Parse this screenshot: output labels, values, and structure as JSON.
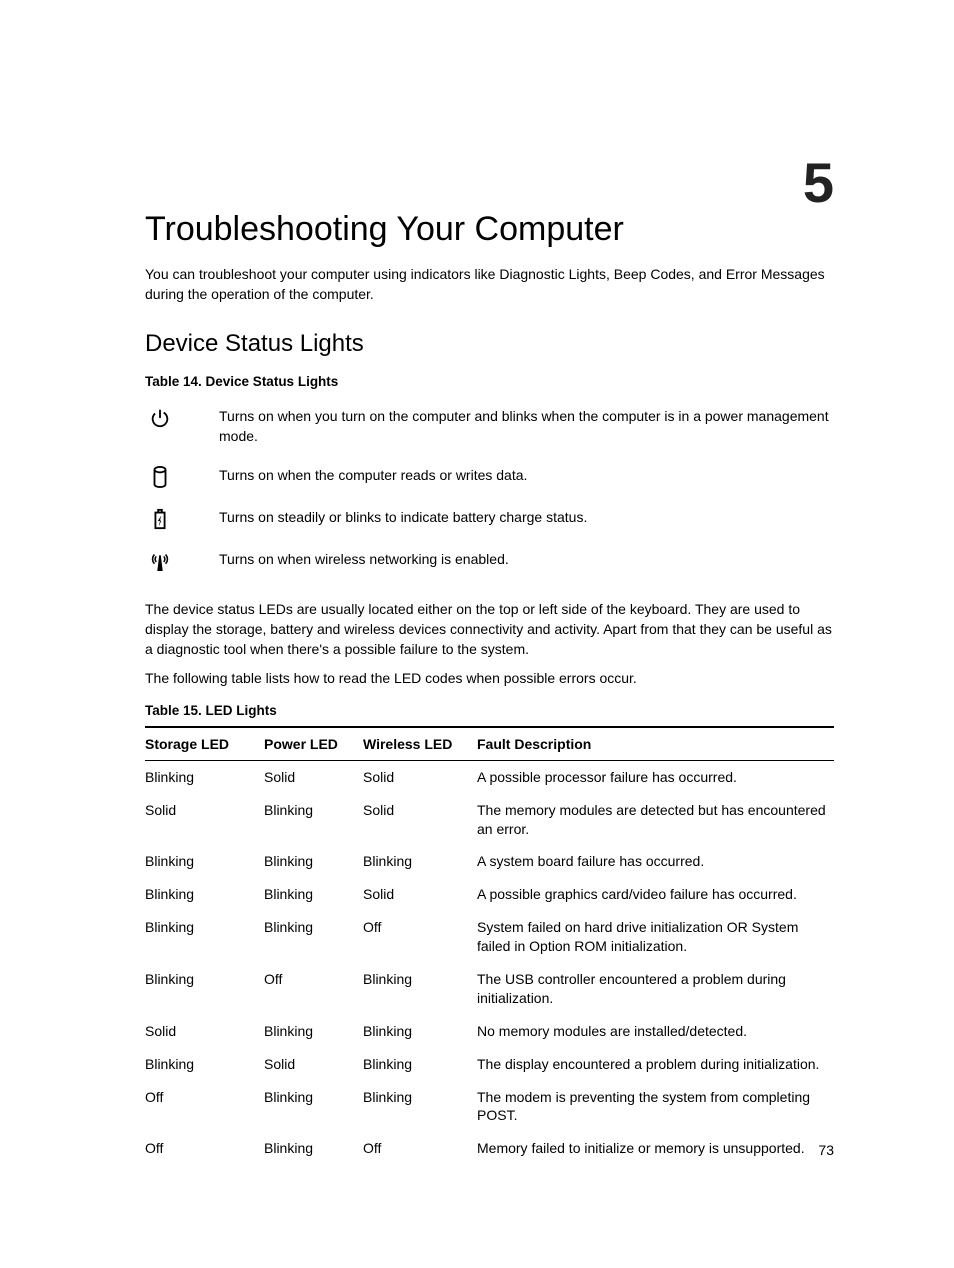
{
  "chapter_number": "5",
  "h1": "Troubleshooting Your Computer",
  "intro": "You can troubleshoot your computer using indicators like Diagnostic Lights, Beep Codes, and Error Messages during the operation of the computer.",
  "h2": "Device Status Lights",
  "table14_caption": "Table 14. Device Status Lights",
  "status_rows": [
    {
      "icon": "power-icon",
      "desc": "Turns on when you turn on the computer and blinks when the computer is in a power management mode."
    },
    {
      "icon": "storage-icon",
      "desc": "Turns on when the computer reads or writes data."
    },
    {
      "icon": "battery-icon",
      "desc": "Turns on steadily or blinks to indicate battery charge status."
    },
    {
      "icon": "wireless-icon",
      "desc": "Turns on when wireless networking is enabled."
    }
  ],
  "para1": "The device status LEDs are usually located either on the top or left side of the keyboard. They are used to display the storage, battery and wireless devices connectivity and activity. Apart from that they can be useful as a diagnostic tool when there's a possible failure to the system.",
  "para2": "The following table lists how to read the LED codes when possible errors occur.",
  "table15_caption": "Table 15. LED Lights",
  "led_headers": {
    "c1": "Storage LED",
    "c2": "Power LED",
    "c3": "Wireless LED",
    "c4": "Fault Description"
  },
  "led_rows": [
    {
      "c1": "Blinking",
      "c2": "Solid",
      "c3": "Solid",
      "c4": "A possible processor failure has occurred."
    },
    {
      "c1": "Solid",
      "c2": "Blinking",
      "c3": "Solid",
      "c4": "The memory modules are detected but has encountered an error."
    },
    {
      "c1": "Blinking",
      "c2": "Blinking",
      "c3": "Blinking",
      "c4": "A system board failure has occurred."
    },
    {
      "c1": "Blinking",
      "c2": "Blinking",
      "c3": "Solid",
      "c4": "A possible graphics card/video failure has occurred."
    },
    {
      "c1": "Blinking",
      "c2": "Blinking",
      "c3": "Off",
      "c4": "System failed on hard drive initialization OR System failed in Option ROM initialization."
    },
    {
      "c1": "Blinking",
      "c2": "Off",
      "c3": "Blinking",
      "c4": "The USB controller encountered a problem during initialization."
    },
    {
      "c1": "Solid",
      "c2": "Blinking",
      "c3": "Blinking",
      "c4": "No memory modules are installed/detected."
    },
    {
      "c1": "Blinking",
      "c2": "Solid",
      "c3": "Blinking",
      "c4": "The display encountered a problem during initialization."
    },
    {
      "c1": "Off",
      "c2": "Blinking",
      "c3": "Blinking",
      "c4": "The modem is preventing the system from completing POST."
    },
    {
      "c1": "Off",
      "c2": "Blinking",
      "c3": "Off",
      "c4": "Memory failed to initialize or memory is unsupported."
    }
  ],
  "page_number": "73"
}
